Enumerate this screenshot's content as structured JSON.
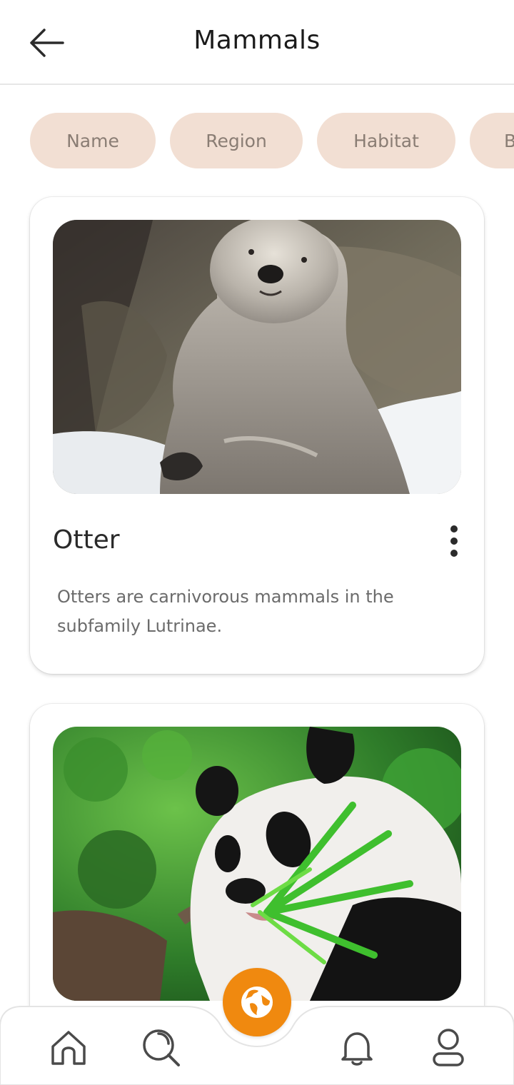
{
  "header": {
    "title": "Mammals",
    "back_icon": "arrow-left-icon"
  },
  "filters": [
    {
      "label": "Name"
    },
    {
      "label": "Region"
    },
    {
      "label": "Habitat"
    },
    {
      "label": "B"
    }
  ],
  "cards": [
    {
      "name": "Otter",
      "description": "Otters are carnivorous mammals in the subfamily Lutrinae.",
      "image": "otter-photo",
      "menu_icon": "more-vertical-icon"
    },
    {
      "name": "",
      "description": "",
      "image": "panda-photo",
      "menu_icon": ""
    }
  ],
  "bottom_nav": {
    "items": [
      {
        "icon": "home-icon"
      },
      {
        "icon": "search-icon"
      },
      {
        "icon": "globe-icon"
      },
      {
        "icon": "bell-icon"
      },
      {
        "icon": "profile-icon"
      }
    ],
    "accent": "#f0890f"
  },
  "colors": {
    "chip_bg": "#f2dfd3",
    "chip_text": "#8a7d74",
    "accent": "#f0890f"
  }
}
